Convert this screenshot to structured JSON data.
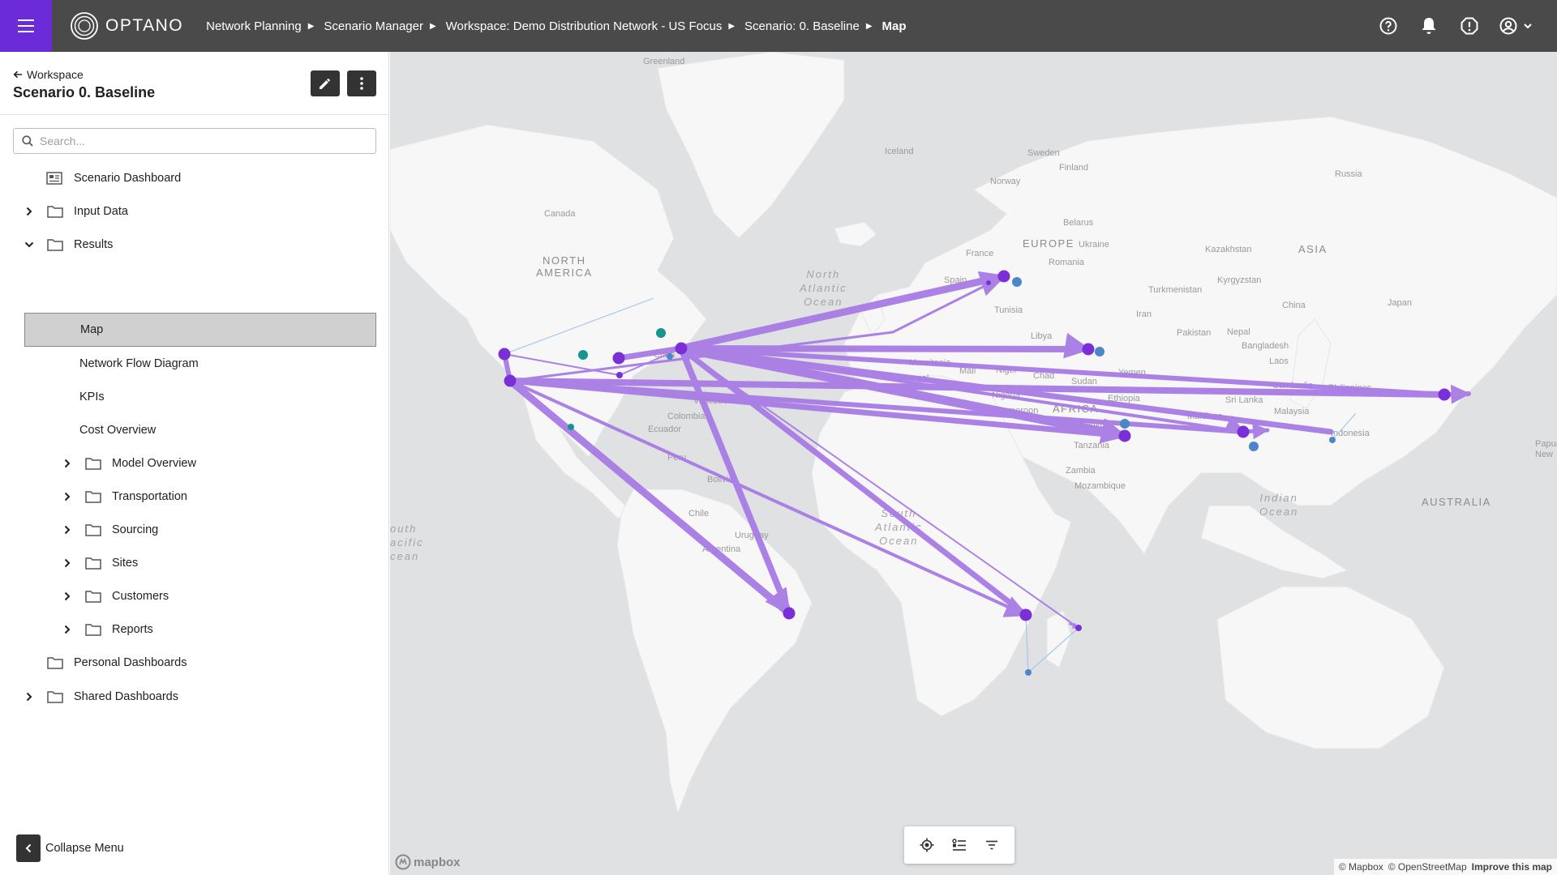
{
  "topbar": {
    "logo_text": "OPTANO",
    "breadcrumbs": [
      {
        "label": "Network Planning"
      },
      {
        "label": "Scenario Manager"
      },
      {
        "label": "Workspace: Demo Distribution Network - US Focus"
      },
      {
        "label": "Scenario: 0. Baseline"
      },
      {
        "label": "Map"
      }
    ],
    "icons": [
      "help-icon",
      "bell-icon",
      "alert-icon",
      "account-icon"
    ]
  },
  "sidebar": {
    "back_label": "Workspace",
    "title": "Scenario 0. Baseline",
    "search_placeholder": "Search...",
    "tree": {
      "scenario_dashboard": "Scenario Dashboard",
      "input_data": "Input Data",
      "results": "Results",
      "map": "Map",
      "network_flow_diagram": "Network Flow Diagram",
      "kpis": "KPIs",
      "cost_overview": "Cost Overview",
      "model_overview": "Model Overview",
      "transportation": "Transportation",
      "sourcing": "Sourcing",
      "sites": "Sites",
      "customers": "Customers",
      "reports": "Reports",
      "personal_dashboards": "Personal Dashboards",
      "shared_dashboards": "Shared Dashboards"
    },
    "collapse_label": "Collapse Menu"
  },
  "map": {
    "labels": {
      "greenland": "Greenland",
      "iceland": "Iceland",
      "sweden": "Sweden",
      "finland": "Finland",
      "norway": "Norway",
      "russia": "Russia",
      "canada": "Canada",
      "north_america_1": "NORTH",
      "north_america_2": "AMERICA",
      "belarus": "Belarus",
      "europe": "EUROPE",
      "ukraine": "Ukraine",
      "france": "France",
      "romania": "Romania",
      "kazakhstan": "Kazakhstan",
      "asia": "ASIA",
      "spain": "Spain",
      "kyrgyzstan": "Kyrgyzstan",
      "turkmenistan": "Turkmenistan",
      "tunisia": "Tunisia",
      "iran": "Iran",
      "china": "China",
      "japan": "Japan",
      "libya": "Libya",
      "pakistan": "Pakistan",
      "nepal": "Nepal",
      "bangladesh": "Bangladesh",
      "cuba": "Cuba",
      "mauritania": "Mauritania",
      "mali": "Mali",
      "niger": "Niger",
      "chad": "Chad",
      "sudan": "Sudan",
      "yemen": "Yemen",
      "laos": "Laos",
      "senegal": "Senegal",
      "venezuela": "Venezuela",
      "colombia": "Colombia",
      "ecuador": "Ecuador",
      "nigeria": "Nigeria",
      "africa": "AFRICA",
      "ethiopia": "Ethiopia",
      "sri_lanka": "Sri Lanka",
      "cambodia": "Cambodia",
      "philippines": "Philippines",
      "cameroon": "Cameroon",
      "maldives": "Maldives",
      "malaysia": "Malaysia",
      "kenya": "Kenya",
      "peru": "Peru",
      "tanzania": "Tanzania",
      "indonesia": "Indonesia",
      "papua": "Papua\nNew",
      "bolivia": "Bolivia",
      "zambia": "Zambia",
      "mozambique": "Mozambique",
      "chile": "Chile",
      "uruguay": "Uruguay",
      "argentina": "Argentina",
      "australia": "AUSTRALIA",
      "north_atlantic": "North\nAtlantic\nOcean",
      "south_atlantic": "South\nAtlantic\nOcean",
      "indian_ocean": "Indian\nOcean",
      "south_pacific": "outh\nacific\ncean"
    },
    "toolbar": [
      "locate-icon",
      "legend-icon",
      "filter-icon"
    ],
    "mapbox_logo": "mapbox",
    "attribution": {
      "mapbox": "© Mapbox",
      "osm": "© OpenStreetMap",
      "improve": "Improve this map"
    },
    "colors": {
      "flow": "#a97be6",
      "plant": "#7b2fd6",
      "warehouse": "#4a86c8",
      "supplier": "#15958d",
      "land": "#f7f7f7",
      "water": "#dfe1e3"
    }
  }
}
